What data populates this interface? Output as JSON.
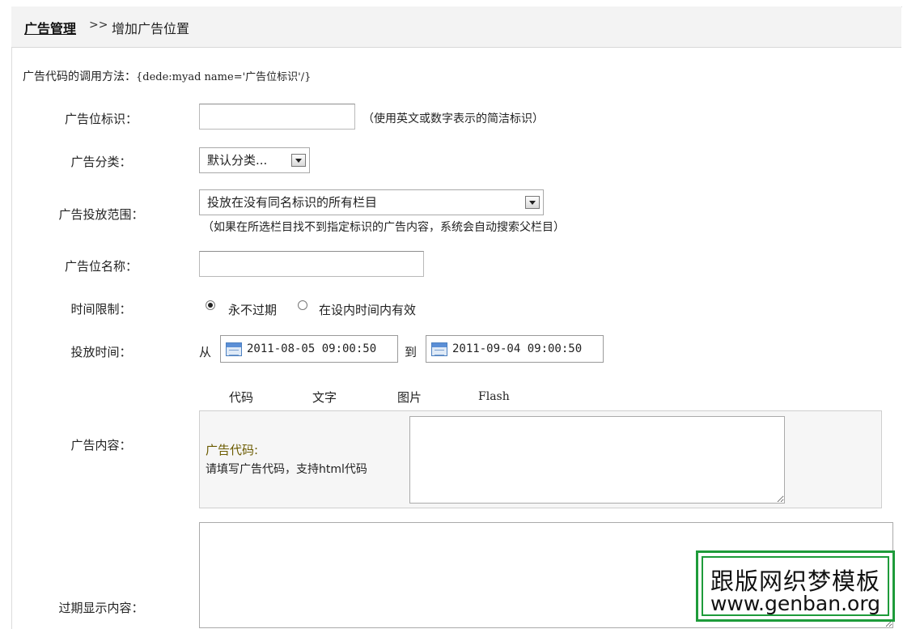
{
  "breadcrumb": {
    "root": "广告管理",
    "separator": ">>",
    "current": "增加广告位置"
  },
  "hint": {
    "label": "广告代码的调用方法：",
    "code": "{dede:myad name='广告位标识'/}"
  },
  "form": {
    "tag": {
      "label": "广告位标识：",
      "value": "",
      "note": "（使用英文或数字表示的简洁标识）"
    },
    "category": {
      "label": "广告分类：",
      "selected": "默认分类..."
    },
    "scope": {
      "label": "广告投放范围：",
      "selected": "投放在没有同名标识的所有栏目",
      "note": "（如果在所选栏目找不到指定标识的广告内容，系统会自动搜索父栏目）"
    },
    "name": {
      "label": "广告位名称：",
      "value": ""
    },
    "time_limit": {
      "label": "时间限制：",
      "options": [
        "永不过期",
        "在设内时间内有效"
      ],
      "selected_index": 0
    },
    "period": {
      "label": "投放时间：",
      "from_label": "从",
      "from": "2011-08-05 09:00:50",
      "to_label": "到",
      "to": "2011-09-04 09:00:50"
    },
    "content": {
      "label": "广告内容：",
      "tabs": [
        "代码",
        "文字",
        "图片",
        "Flash"
      ],
      "code_title": "广告代码:",
      "code_desc": "请填写广告代码，支持html代码",
      "code_value": ""
    },
    "expired": {
      "label": "过期显示内容：",
      "value": ""
    }
  },
  "watermark": {
    "line1": "跟版网织梦模板",
    "line2": "www.genban.org"
  },
  "colors": {
    "watermark_border": "#1e9b3a",
    "code_title": "#6b5b00"
  }
}
